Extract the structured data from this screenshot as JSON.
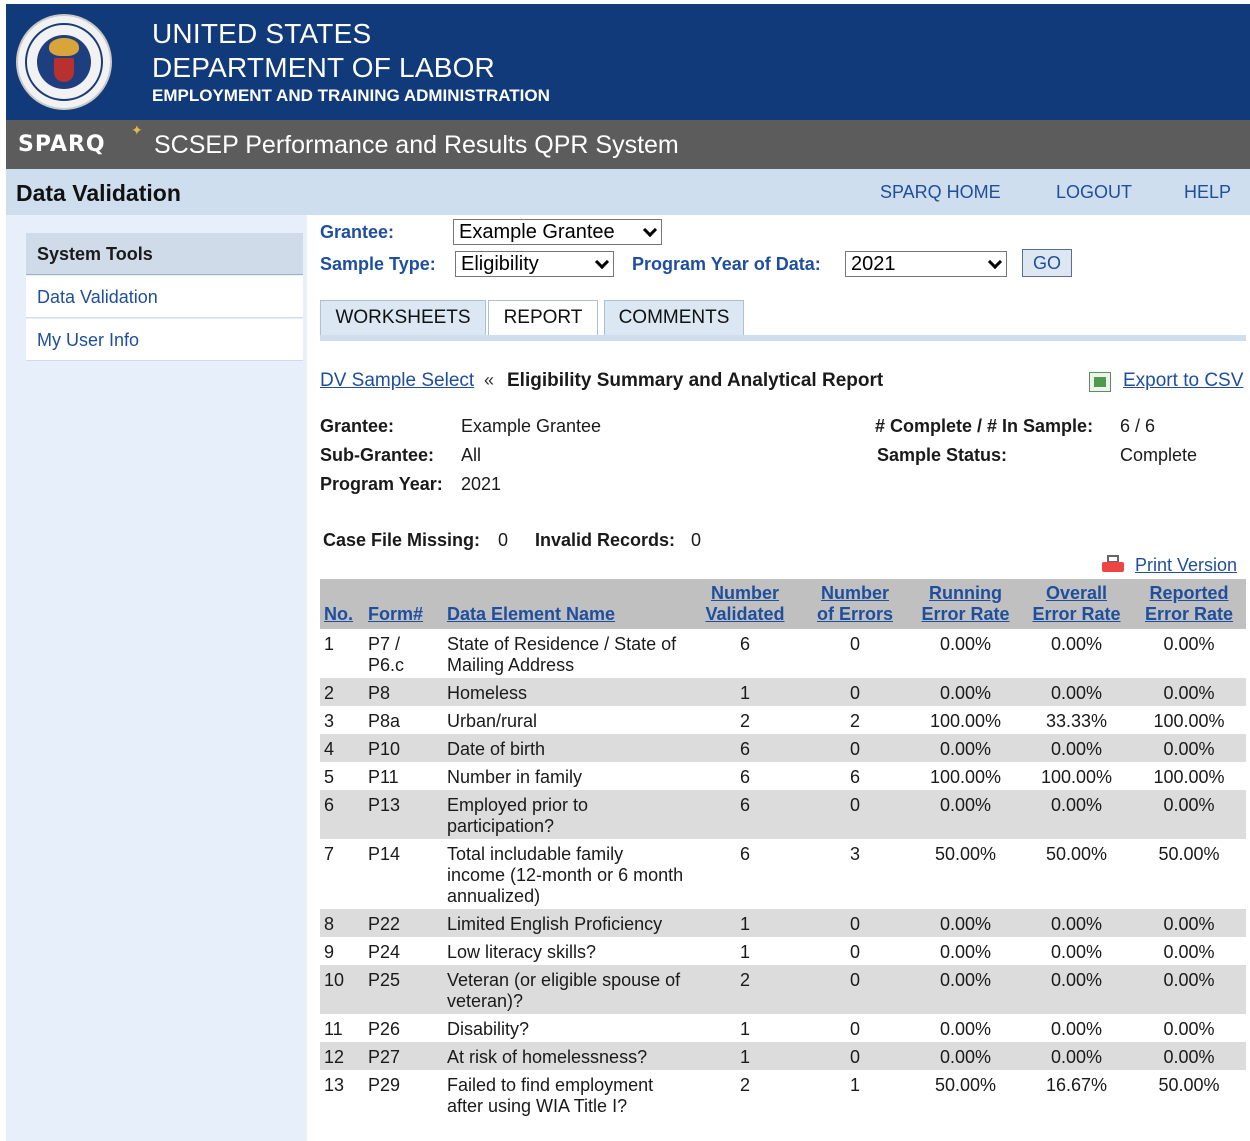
{
  "header": {
    "line1": "UNITED STATES",
    "line2": "DEPARTMENT OF LABOR",
    "line3": "EMPLOYMENT AND TRAINING ADMINISTRATION"
  },
  "sparq": {
    "logo": "SPARQ",
    "title": "SCSEP Performance and Results QPR System"
  },
  "section": {
    "title": "Data Validation",
    "links": {
      "home": "SPARQ HOME",
      "logout": "LOGOUT",
      "help": "HELP"
    }
  },
  "sidebar": {
    "heading": "System Tools",
    "items": [
      {
        "label": "Data Validation"
      },
      {
        "label": "My User Info"
      }
    ]
  },
  "controls": {
    "grantee_label": "Grantee:",
    "grantee_value": "Example Grantee",
    "sample_type_label": "Sample Type:",
    "sample_type_value": "Eligibility",
    "program_year_label": "Program Year of Data:",
    "program_year_value": "2021",
    "go_label": "GO"
  },
  "tabs": [
    {
      "label": "WORKSHEETS"
    },
    {
      "label": "REPORT"
    },
    {
      "label": "COMMENTS"
    }
  ],
  "report": {
    "breadcrumb_link": "DV Sample Select",
    "breadcrumb_sep": "«",
    "title": "Eligibility Summary and Analytical Report",
    "export_label": "Export to CSV",
    "print_label": "Print Version",
    "grantee_label": "Grantee:",
    "grantee_value": "Example Grantee",
    "subgrantee_label": "Sub-Grantee:",
    "subgrantee_value": "All",
    "program_year_label": "Program Year:",
    "program_year_value": "2021",
    "complete_label": "# Complete / # In Sample:",
    "complete_value": "6 / 6",
    "status_label": "Sample Status:",
    "status_value": "Complete",
    "case_missing_label": "Case File Missing:",
    "case_missing_value": "0",
    "invalid_label": "Invalid Records:",
    "invalid_value": "0"
  },
  "table": {
    "headers": {
      "no": "No.",
      "form": "Form#",
      "element": "Data Element Name",
      "validated_1": "Number",
      "validated_2": "Validated",
      "errors_1": "Number",
      "errors_2": "of Errors",
      "running_1": "Running",
      "running_2": "Error Rate",
      "overall_1": "Overall",
      "overall_2": "Error Rate",
      "reported_1": "Reported",
      "reported_2": "Error Rate"
    },
    "rows": [
      {
        "no": "1",
        "form": "P7 / P6.c",
        "element": "State of Residence / State of Mailing Address",
        "validated": "6",
        "errors": "0",
        "running": "0.00%",
        "overall": "0.00%",
        "reported": "0.00%"
      },
      {
        "no": "2",
        "form": "P8",
        "element": "Homeless",
        "validated": "1",
        "errors": "0",
        "running": "0.00%",
        "overall": "0.00%",
        "reported": "0.00%"
      },
      {
        "no": "3",
        "form": "P8a",
        "element": "Urban/rural",
        "validated": "2",
        "errors": "2",
        "running": "100.00%",
        "overall": "33.33%",
        "reported": "100.00%"
      },
      {
        "no": "4",
        "form": "P10",
        "element": "Date of birth",
        "validated": "6",
        "errors": "0",
        "running": "0.00%",
        "overall": "0.00%",
        "reported": "0.00%"
      },
      {
        "no": "5",
        "form": "P11",
        "element": "Number in family",
        "validated": "6",
        "errors": "6",
        "running": "100.00%",
        "overall": "100.00%",
        "reported": "100.00%"
      },
      {
        "no": "6",
        "form": "P13",
        "element": "Employed prior to participation?",
        "validated": "6",
        "errors": "0",
        "running": "0.00%",
        "overall": "0.00%",
        "reported": "0.00%"
      },
      {
        "no": "7",
        "form": "P14",
        "element": "Total includable family income (12-month or 6 month annualized)",
        "validated": "6",
        "errors": "3",
        "running": "50.00%",
        "overall": "50.00%",
        "reported": "50.00%"
      },
      {
        "no": "8",
        "form": "P22",
        "element": "Limited English Proficiency",
        "validated": "1",
        "errors": "0",
        "running": "0.00%",
        "overall": "0.00%",
        "reported": "0.00%"
      },
      {
        "no": "9",
        "form": "P24",
        "element": "Low literacy skills?",
        "validated": "1",
        "errors": "0",
        "running": "0.00%",
        "overall": "0.00%",
        "reported": "0.00%"
      },
      {
        "no": "10",
        "form": "P25",
        "element": "Veteran (or eligible spouse of veteran)?",
        "validated": "2",
        "errors": "0",
        "running": "0.00%",
        "overall": "0.00%",
        "reported": "0.00%"
      },
      {
        "no": "11",
        "form": "P26",
        "element": "Disability?",
        "validated": "1",
        "errors": "0",
        "running": "0.00%",
        "overall": "0.00%",
        "reported": "0.00%"
      },
      {
        "no": "12",
        "form": "P27",
        "element": "At risk of homelessness?",
        "validated": "1",
        "errors": "0",
        "running": "0.00%",
        "overall": "0.00%",
        "reported": "0.00%"
      },
      {
        "no": "13",
        "form": "P29",
        "element": "Failed to find employment after using WIA Title I?",
        "validated": "2",
        "errors": "1",
        "running": "50.00%",
        "overall": "16.67%",
        "reported": "50.00%"
      }
    ]
  }
}
